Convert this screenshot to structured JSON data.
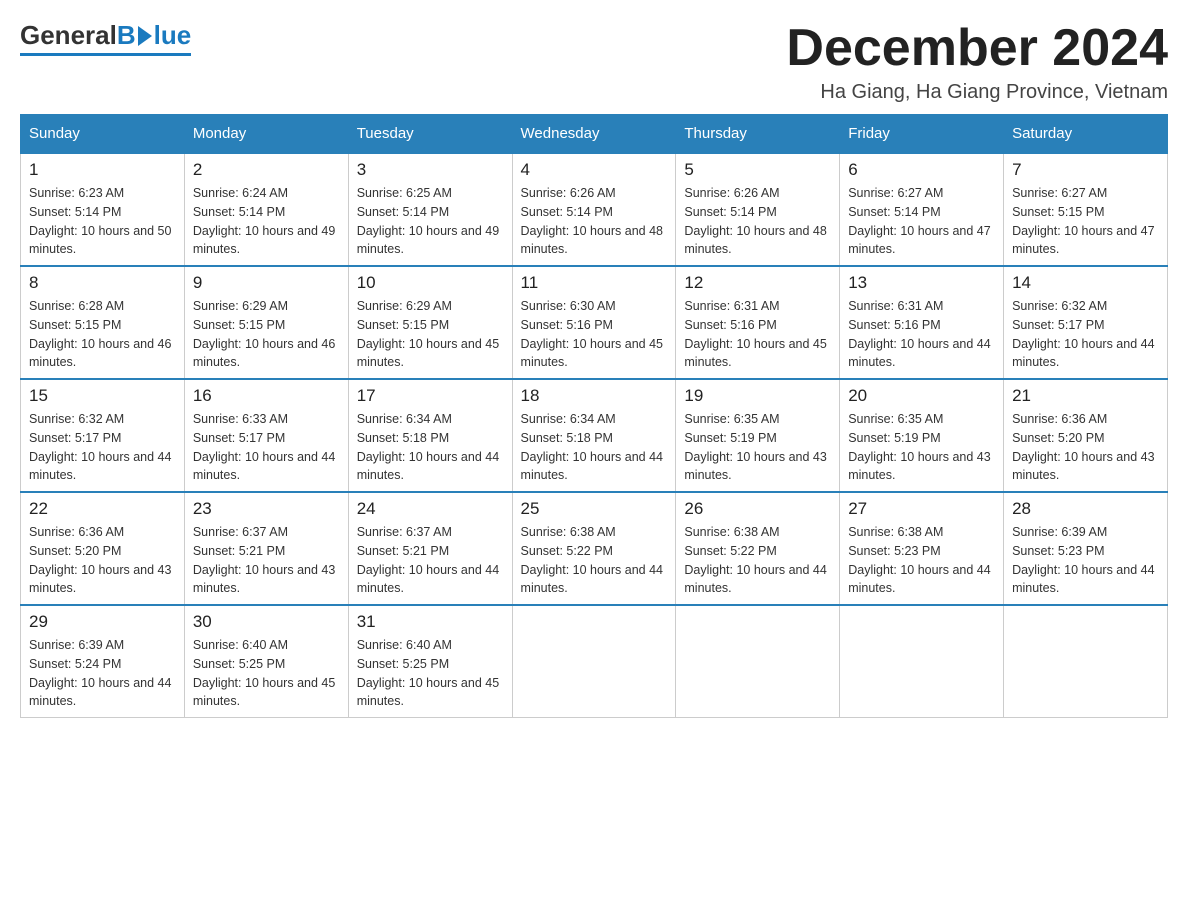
{
  "header": {
    "logo": {
      "general": "General",
      "blue": "Blue",
      "tagline": "Blue"
    },
    "title": "December 2024",
    "location": "Ha Giang, Ha Giang Province, Vietnam"
  },
  "days_of_week": [
    "Sunday",
    "Monday",
    "Tuesday",
    "Wednesday",
    "Thursday",
    "Friday",
    "Saturday"
  ],
  "weeks": [
    [
      {
        "day": 1,
        "sunrise": "6:23 AM",
        "sunset": "5:14 PM",
        "daylight": "10 hours and 50 minutes."
      },
      {
        "day": 2,
        "sunrise": "6:24 AM",
        "sunset": "5:14 PM",
        "daylight": "10 hours and 49 minutes."
      },
      {
        "day": 3,
        "sunrise": "6:25 AM",
        "sunset": "5:14 PM",
        "daylight": "10 hours and 49 minutes."
      },
      {
        "day": 4,
        "sunrise": "6:26 AM",
        "sunset": "5:14 PM",
        "daylight": "10 hours and 48 minutes."
      },
      {
        "day": 5,
        "sunrise": "6:26 AM",
        "sunset": "5:14 PM",
        "daylight": "10 hours and 48 minutes."
      },
      {
        "day": 6,
        "sunrise": "6:27 AM",
        "sunset": "5:14 PM",
        "daylight": "10 hours and 47 minutes."
      },
      {
        "day": 7,
        "sunrise": "6:27 AM",
        "sunset": "5:15 PM",
        "daylight": "10 hours and 47 minutes."
      }
    ],
    [
      {
        "day": 8,
        "sunrise": "6:28 AM",
        "sunset": "5:15 PM",
        "daylight": "10 hours and 46 minutes."
      },
      {
        "day": 9,
        "sunrise": "6:29 AM",
        "sunset": "5:15 PM",
        "daylight": "10 hours and 46 minutes."
      },
      {
        "day": 10,
        "sunrise": "6:29 AM",
        "sunset": "5:15 PM",
        "daylight": "10 hours and 45 minutes."
      },
      {
        "day": 11,
        "sunrise": "6:30 AM",
        "sunset": "5:16 PM",
        "daylight": "10 hours and 45 minutes."
      },
      {
        "day": 12,
        "sunrise": "6:31 AM",
        "sunset": "5:16 PM",
        "daylight": "10 hours and 45 minutes."
      },
      {
        "day": 13,
        "sunrise": "6:31 AM",
        "sunset": "5:16 PM",
        "daylight": "10 hours and 44 minutes."
      },
      {
        "day": 14,
        "sunrise": "6:32 AM",
        "sunset": "5:17 PM",
        "daylight": "10 hours and 44 minutes."
      }
    ],
    [
      {
        "day": 15,
        "sunrise": "6:32 AM",
        "sunset": "5:17 PM",
        "daylight": "10 hours and 44 minutes."
      },
      {
        "day": 16,
        "sunrise": "6:33 AM",
        "sunset": "5:17 PM",
        "daylight": "10 hours and 44 minutes."
      },
      {
        "day": 17,
        "sunrise": "6:34 AM",
        "sunset": "5:18 PM",
        "daylight": "10 hours and 44 minutes."
      },
      {
        "day": 18,
        "sunrise": "6:34 AM",
        "sunset": "5:18 PM",
        "daylight": "10 hours and 44 minutes."
      },
      {
        "day": 19,
        "sunrise": "6:35 AM",
        "sunset": "5:19 PM",
        "daylight": "10 hours and 43 minutes."
      },
      {
        "day": 20,
        "sunrise": "6:35 AM",
        "sunset": "5:19 PM",
        "daylight": "10 hours and 43 minutes."
      },
      {
        "day": 21,
        "sunrise": "6:36 AM",
        "sunset": "5:20 PM",
        "daylight": "10 hours and 43 minutes."
      }
    ],
    [
      {
        "day": 22,
        "sunrise": "6:36 AM",
        "sunset": "5:20 PM",
        "daylight": "10 hours and 43 minutes."
      },
      {
        "day": 23,
        "sunrise": "6:37 AM",
        "sunset": "5:21 PM",
        "daylight": "10 hours and 43 minutes."
      },
      {
        "day": 24,
        "sunrise": "6:37 AM",
        "sunset": "5:21 PM",
        "daylight": "10 hours and 44 minutes."
      },
      {
        "day": 25,
        "sunrise": "6:38 AM",
        "sunset": "5:22 PM",
        "daylight": "10 hours and 44 minutes."
      },
      {
        "day": 26,
        "sunrise": "6:38 AM",
        "sunset": "5:22 PM",
        "daylight": "10 hours and 44 minutes."
      },
      {
        "day": 27,
        "sunrise": "6:38 AM",
        "sunset": "5:23 PM",
        "daylight": "10 hours and 44 minutes."
      },
      {
        "day": 28,
        "sunrise": "6:39 AM",
        "sunset": "5:23 PM",
        "daylight": "10 hours and 44 minutes."
      }
    ],
    [
      {
        "day": 29,
        "sunrise": "6:39 AM",
        "sunset": "5:24 PM",
        "daylight": "10 hours and 44 minutes."
      },
      {
        "day": 30,
        "sunrise": "6:40 AM",
        "sunset": "5:25 PM",
        "daylight": "10 hours and 45 minutes."
      },
      {
        "day": 31,
        "sunrise": "6:40 AM",
        "sunset": "5:25 PM",
        "daylight": "10 hours and 45 minutes."
      },
      null,
      null,
      null,
      null
    ]
  ],
  "labels": {
    "sunrise": "Sunrise:",
    "sunset": "Sunset:",
    "daylight": "Daylight:"
  }
}
